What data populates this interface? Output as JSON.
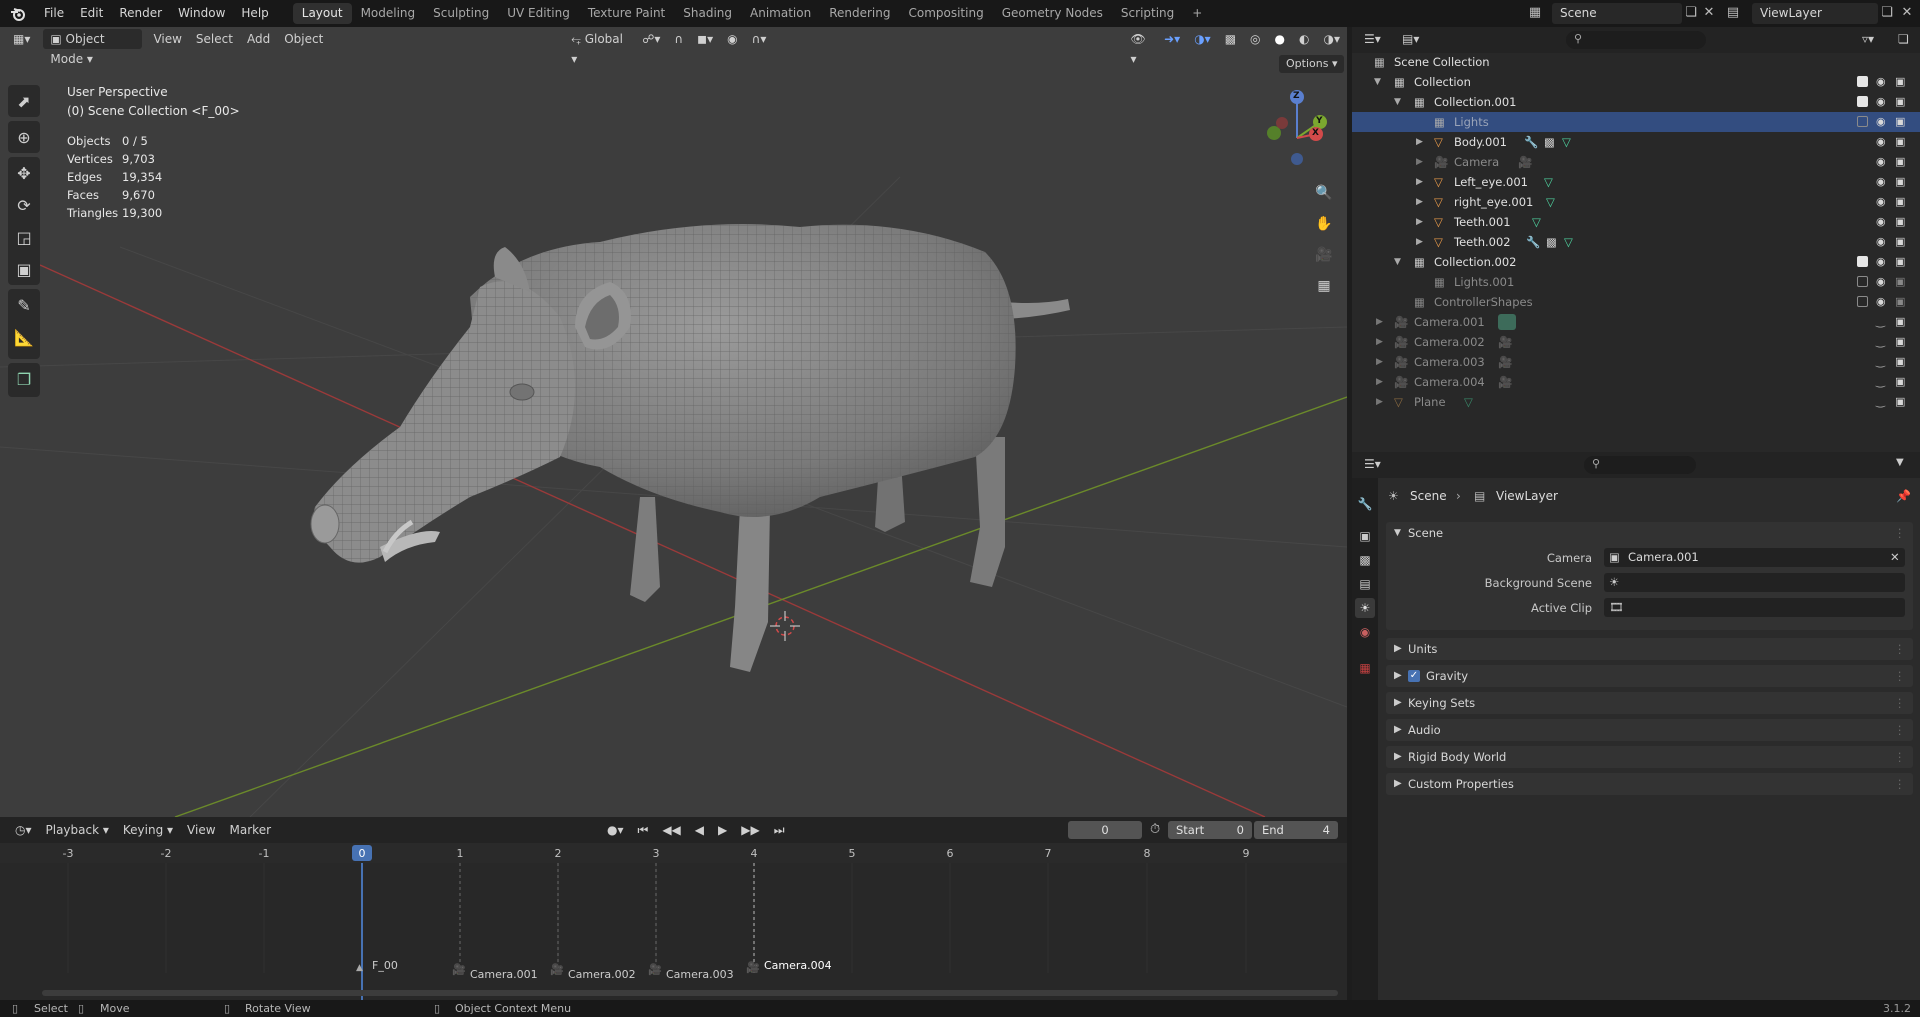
{
  "topbar": {
    "menus": [
      "File",
      "Edit",
      "Render",
      "Window",
      "Help"
    ],
    "workspaces": [
      "Layout",
      "Modeling",
      "Sculpting",
      "UV Editing",
      "Texture Paint",
      "Shading",
      "Animation",
      "Rendering",
      "Compositing",
      "Geometry Nodes",
      "Scripting"
    ],
    "active_workspace": "Layout",
    "add_tab": "+",
    "scene": "Scene",
    "view_layer": "ViewLayer"
  },
  "viewport": {
    "mode": "Object Mode",
    "menus": [
      "View",
      "Select",
      "Add",
      "Object"
    ],
    "orientation": "Global",
    "options": "Options",
    "overlay_title": "User Perspective",
    "overlay_subtitle": "(0) Scene Collection <F_00>",
    "stats": [
      {
        "label": "Objects",
        "value": "0 / 5"
      },
      {
        "label": "Vertices",
        "value": "9,703"
      },
      {
        "label": "Edges",
        "value": "19,354"
      },
      {
        "label": "Faces",
        "value": "9,670"
      },
      {
        "label": "Triangles",
        "value": "19,300"
      }
    ],
    "gizmo": {
      "x": "X",
      "y": "Y",
      "z": "Z"
    }
  },
  "timeline": {
    "menus": [
      "Playback",
      "Keying",
      "View",
      "Marker"
    ],
    "current_frame": "0",
    "start_label": "Start",
    "start_value": "0",
    "end_label": "End",
    "end_value": "4",
    "ticks": [
      "-3",
      "-2",
      "-1",
      "0",
      "1",
      "2",
      "3",
      "4",
      "5",
      "6",
      "7",
      "8",
      "9"
    ],
    "markers": [
      "F_00",
      "Camera.001",
      "Camera.002",
      "Camera.003",
      "Camera.004"
    ]
  },
  "statusbar": {
    "select": "Select",
    "move": "Move",
    "rotate": "Rotate View",
    "context": "Object Context Menu",
    "version": "3.1.2"
  },
  "outliner": {
    "rows": [
      {
        "label": "Scene Collection"
      },
      {
        "label": "Collection"
      },
      {
        "label": "Collection.001"
      },
      {
        "label": "Lights"
      },
      {
        "label": "Body.001"
      },
      {
        "label": "Camera"
      },
      {
        "label": "Left_eye.001"
      },
      {
        "label": "right_eye.001"
      },
      {
        "label": "Teeth.001"
      },
      {
        "label": "Teeth.002"
      },
      {
        "label": "Collection.002"
      },
      {
        "label": "Lights.001"
      },
      {
        "label": "ControllerShapes"
      },
      {
        "label": "Camera.001"
      },
      {
        "label": "Camera.002"
      },
      {
        "label": "Camera.003"
      },
      {
        "label": "Camera.004"
      },
      {
        "label": "Plane"
      }
    ]
  },
  "properties": {
    "breadcrumb_scene": "Scene",
    "breadcrumb_viewlayer": "ViewLayer",
    "scene_panel": "Scene",
    "camera_label": "Camera",
    "camera_value": "Camera.001",
    "background_label": "Background Scene",
    "clip_label": "Active Clip",
    "panels": [
      "Units",
      "Gravity",
      "Keying Sets",
      "Audio",
      "Rigid Body World",
      "Custom Properties"
    ]
  }
}
